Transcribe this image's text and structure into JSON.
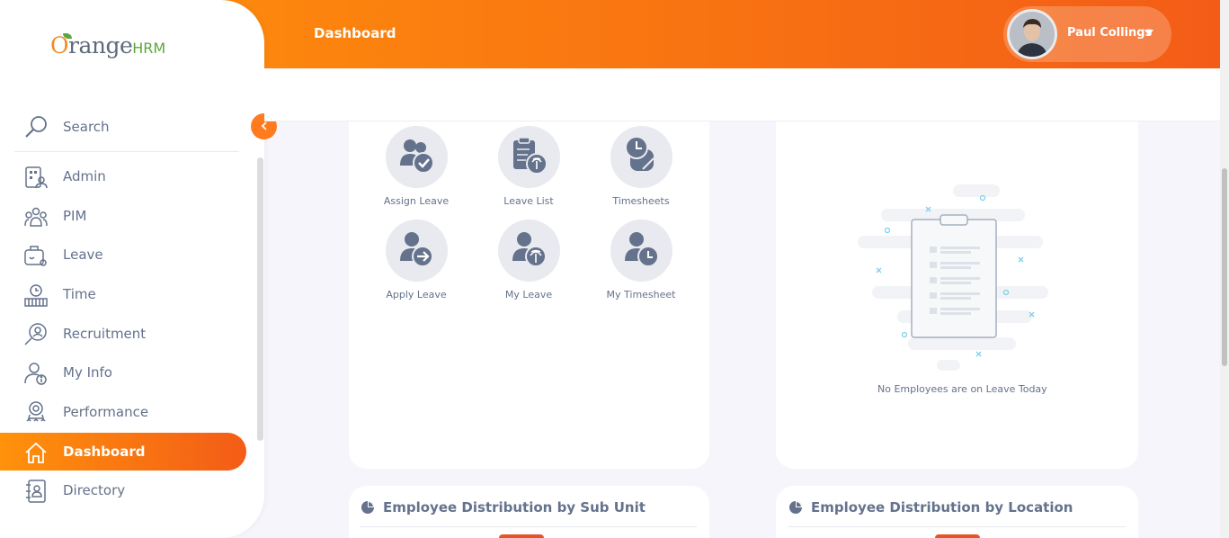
{
  "header": {
    "page_title": "Dashboard",
    "user_name": "Paul Collings"
  },
  "brand": {
    "prefix": "O",
    "word": "range",
    "suffix": "HRM"
  },
  "sidebar": {
    "search_label": "Search",
    "items": [
      {
        "label": "Admin",
        "icon": "admin-icon"
      },
      {
        "label": "PIM",
        "icon": "pim-icon"
      },
      {
        "label": "Leave",
        "icon": "leave-icon"
      },
      {
        "label": "Time",
        "icon": "time-icon"
      },
      {
        "label": "Recruitment",
        "icon": "recruitment-icon"
      },
      {
        "label": "My Info",
        "icon": "my-info-icon"
      },
      {
        "label": "Performance",
        "icon": "performance-icon"
      },
      {
        "label": "Dashboard",
        "icon": "home-icon",
        "active": true
      },
      {
        "label": "Directory",
        "icon": "directory-icon"
      }
    ]
  },
  "quick_launch": {
    "items": [
      {
        "label": "Assign Leave",
        "icon": "assign-leave-icon"
      },
      {
        "label": "Leave List",
        "icon": "leave-list-icon"
      },
      {
        "label": "Timesheets",
        "icon": "timesheets-icon"
      },
      {
        "label": "Apply Leave",
        "icon": "apply-leave-icon"
      },
      {
        "label": "My Leave",
        "icon": "my-leave-icon"
      },
      {
        "label": "My Timesheet",
        "icon": "my-timesheet-icon"
      }
    ]
  },
  "leave_today": {
    "empty_message": "No Employees are on Leave Today"
  },
  "widgets": {
    "sub_unit_title": "Employee Distribution by Sub Unit",
    "location_title": "Employee Distribution by Location"
  },
  "colors": {
    "accent_start": "#ff920b",
    "accent_end": "#f35c17",
    "icon_fill": "#64728c"
  }
}
